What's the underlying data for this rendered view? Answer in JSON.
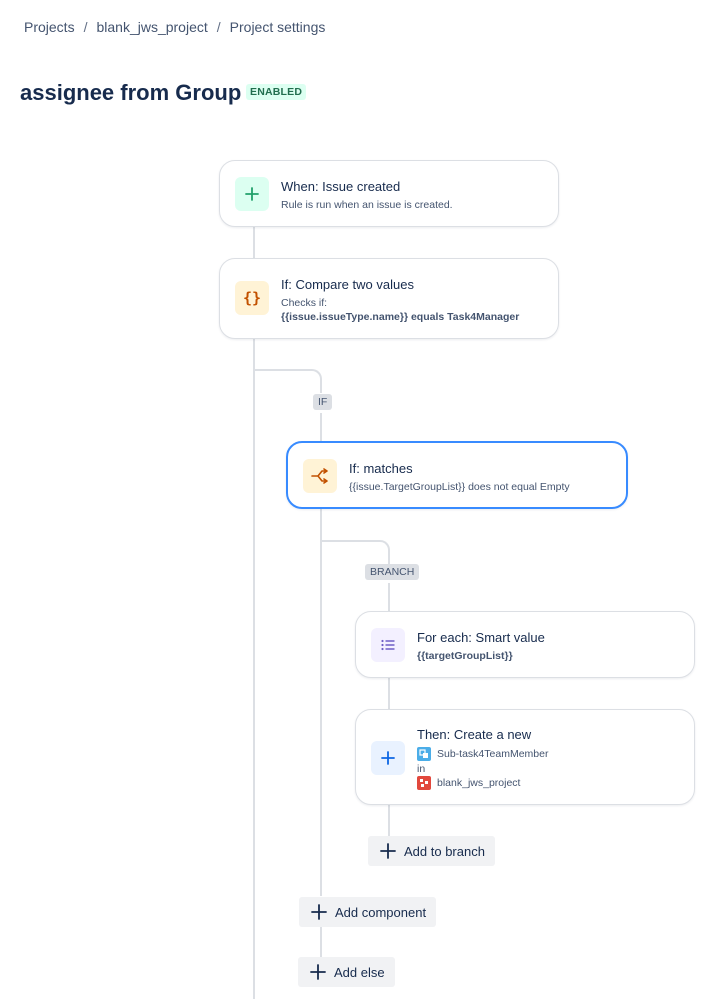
{
  "breadcrumb": {
    "items": [
      "Projects",
      "blank_jws_project",
      "Project settings"
    ],
    "separator": "/"
  },
  "page": {
    "title": "assignee from Group",
    "status": "ENABLED"
  },
  "rule": {
    "trigger": {
      "title": "When: Issue created",
      "description": "Rule is run when an issue is created.",
      "icon": "plus-icon",
      "color": "#22a06b"
    },
    "condition": {
      "title": "If: Compare two values",
      "line1": "Checks if:",
      "line2": "{{issue.issueType.name}} equals Task4Manager",
      "icon": "braces-icon",
      "color": "#c25100"
    },
    "if_label": "IF",
    "if_block": {
      "title": "If: matches",
      "description": "{{issue.TargetGroupList}} does not equal Empty",
      "icon": "branch-icon",
      "color": "#c25100"
    },
    "branch_label": "BRANCH",
    "branch": {
      "title": "For each: Smart value",
      "description": "{{targetGroupList}}",
      "icon": "list-icon",
      "color": "#6e5dc6"
    },
    "action": {
      "title": "Then: Create a new",
      "issue_type": "Sub-task4TeamMember",
      "connector": "in",
      "project": "blank_jws_project",
      "icon": "plus-icon",
      "color": "#0c66e4"
    },
    "add_to_branch": "Add to branch",
    "add_component": "Add component",
    "add_else": "Add else"
  }
}
